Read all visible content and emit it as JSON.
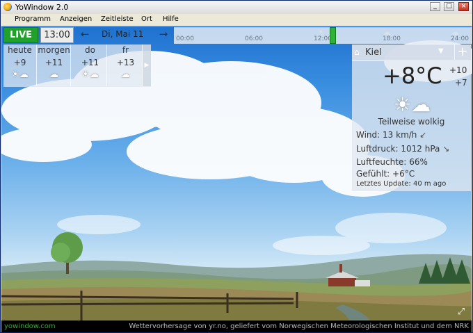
{
  "window": {
    "title": "YoWindow 2.0"
  },
  "title_buttons": {
    "minimize": "_",
    "maximize": "□",
    "close": "×"
  },
  "menu": [
    "Programm",
    "Anzeigen",
    "Zeitleiste",
    "Ort",
    "Hilfe"
  ],
  "timebar": {
    "live": "LIVE",
    "time": "13:00",
    "prev_arrow": "←",
    "next_arrow": "→",
    "date": "Di, Mai 11",
    "ticks": [
      "00:00",
      "06:00",
      "12:00",
      "18:00",
      "24:00"
    ]
  },
  "forecast": {
    "days": [
      {
        "name": "heute",
        "temp": "+9",
        "icon": "partly-cloudy-icon"
      },
      {
        "name": "morgen",
        "temp": "+11",
        "icon": "cloud-icon"
      },
      {
        "name": "do",
        "temp": "+11",
        "icon": "partly-cloudy-icon"
      },
      {
        "name": "fr",
        "temp": "+13",
        "icon": "cloud-icon"
      }
    ],
    "next_arrow": "▶"
  },
  "weather": {
    "city": "Kiel",
    "dropdown": "▼",
    "add": "+",
    "temperature": "+8°C",
    "high": "+10",
    "low": "+7",
    "condition": "Teilweise wolkig",
    "wind_label": "Wind:",
    "wind_value": "13 km/h",
    "wind_arrow": "↙",
    "pressure_label": "Luftdruck:",
    "pressure_value": "1012 hPa",
    "pressure_arrow": "↘",
    "humidity_label": "Luftfeuchte:",
    "humidity_value": "66%",
    "feels_label": "Gefühlt:",
    "feels_value": "+6°C",
    "update_label": "Letztes Update:",
    "update_value": "40 m ago"
  },
  "footer": {
    "brand": "yowindow.com",
    "credit": "Wettervorhersage von yr.no, geliefert vom Norwegischen Meteorologischen Institut und dem NRK"
  }
}
